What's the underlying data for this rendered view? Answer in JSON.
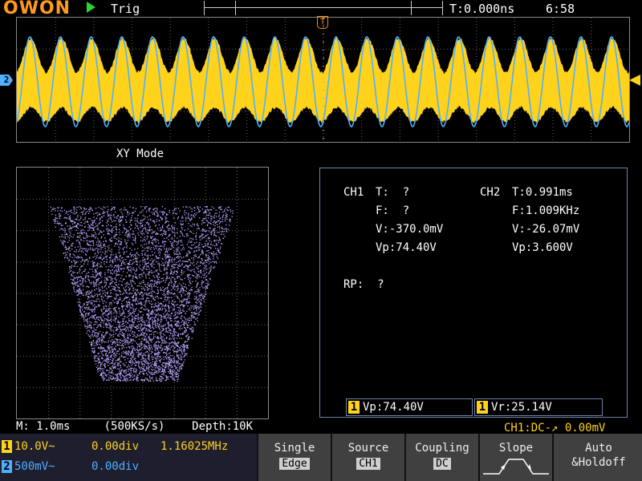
{
  "brand": "OWON",
  "topbar": {
    "trig_state": "Trig",
    "trigger_time": "T:0.000ns",
    "clock": "6:58",
    "trig_pos_glyph": "T",
    "ch2_marker": "2"
  },
  "xy_title": "XY Mode",
  "measure": {
    "ch1": {
      "label": "CH1",
      "T": "T:  ?",
      "F": "F:  ?",
      "V": "V:-370.0mV",
      "Vp": "Vp:74.40V"
    },
    "ch2": {
      "label": "CH2",
      "T": "T:0.991ms",
      "F": "F:1.009KHz",
      "V": "V:-26.07mV",
      "Vp": "Vp:3.600V"
    },
    "rp": "RP:  ?",
    "box1": {
      "ch": "1",
      "text": "Vp:74.40V"
    },
    "box2": {
      "ch": "1",
      "text": "Vr:25.14V"
    }
  },
  "status": {
    "timebase": "M: 1.0ms",
    "sample_rate": "(500KS/s)",
    "depth": "Depth:10K",
    "trigger": "CH1:DC-↗ 0.00mV"
  },
  "channels": [
    {
      "num": "1",
      "scale": "10.0V~",
      "offset": "0.00div",
      "freq": "1.16025MHz",
      "color": "#ffd21c"
    },
    {
      "num": "2",
      "scale": "500mV~",
      "offset": "0.00div",
      "freq": "",
      "color": "#4fb0ff"
    }
  ],
  "softkeys": [
    {
      "title": "Single",
      "value": "Edge"
    },
    {
      "title": "Source",
      "value": "CH1"
    },
    {
      "title": "Coupling",
      "value": "DC"
    },
    {
      "title": "Slope",
      "value": ""
    },
    {
      "title": "Auto",
      "value": "&Holdoff"
    }
  ],
  "colors": {
    "ch1": "#ffd21c",
    "ch2": "#4fb0ff",
    "xy": "#b9a2ff",
    "brand": "#ff9a1c"
  }
}
